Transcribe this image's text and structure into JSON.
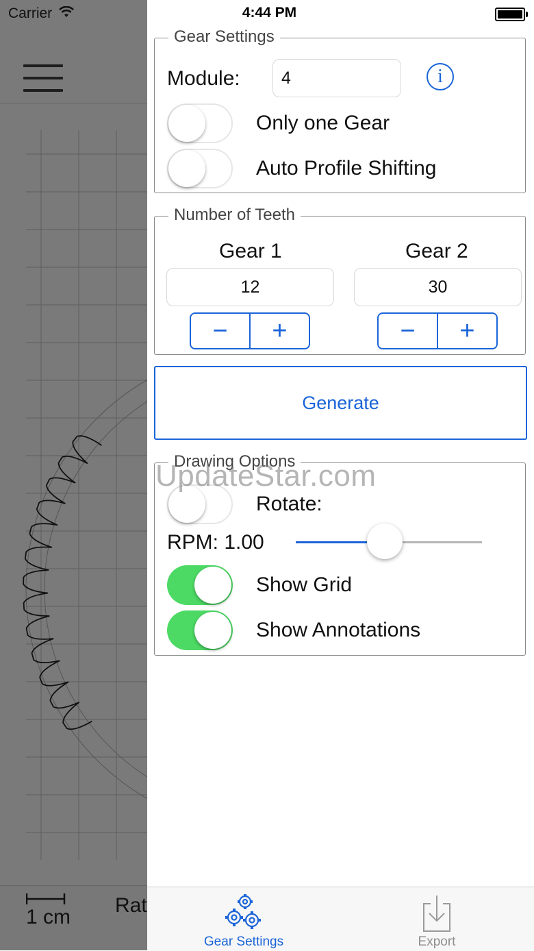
{
  "status_bar": {
    "carrier": "Carrier",
    "time": "4:44 PM"
  },
  "canvas": {
    "scale_label": "1 cm",
    "ratio_label": "Rat"
  },
  "gear_settings": {
    "legend": "Gear Settings",
    "module_label": "Module:",
    "module_value": "4",
    "only_one_gear_label": "Only one Gear",
    "only_one_gear_on": false,
    "auto_profile_label": "Auto Profile Shifting",
    "auto_profile_on": false
  },
  "teeth": {
    "legend": "Number of Teeth",
    "gear1_label": "Gear 1",
    "gear1_value": "12",
    "gear2_label": "Gear 2",
    "gear2_value": "30"
  },
  "generate_label": "Generate",
  "drawing_options": {
    "legend": "Drawing Options",
    "rotate_label": "Rotate:",
    "rotate_on": false,
    "rpm_label": "RPM: 1.00",
    "rpm_slider_fraction": 0.48,
    "show_grid_label": "Show Grid",
    "show_grid_on": true,
    "show_annotations_label": "Show Annotations",
    "show_annotations_on": true
  },
  "watermark": "UpdateStar.com",
  "tabs": [
    {
      "label": "Gear Settings",
      "icon": "gears-icon",
      "active": true
    },
    {
      "label": "Export",
      "icon": "export-icon",
      "active": false
    }
  ],
  "colors": {
    "accent": "#1a64d8",
    "toggle_on": "#4cd964",
    "dim": "#7a7a7a"
  }
}
